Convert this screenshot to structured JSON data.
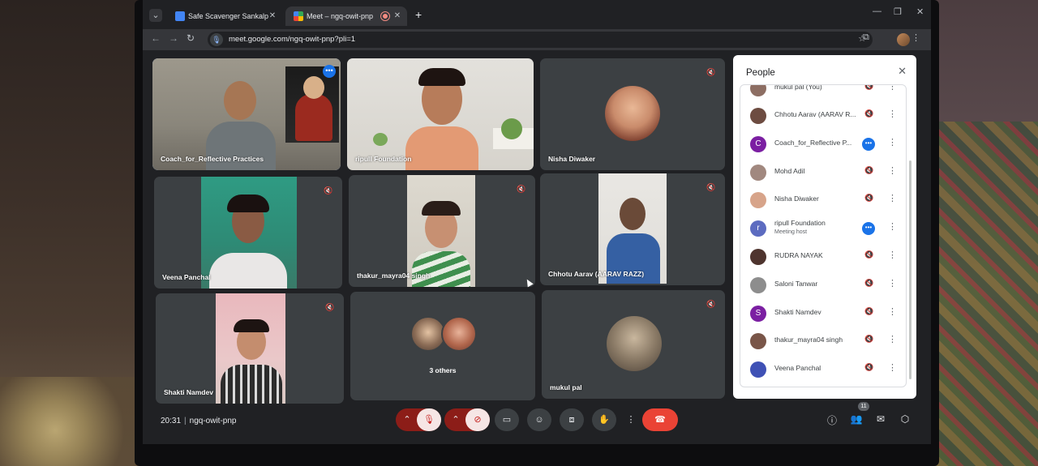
{
  "browser": {
    "tabs": [
      {
        "title": "Safe Scavenger Sankalp",
        "favicon": "docs-icon",
        "active": false
      },
      {
        "title": "Meet – ngq-owit-pnp",
        "favicon": "meet-icon",
        "active": true,
        "recording": true
      }
    ],
    "new_tab": "+",
    "url": "meet.google.com/ngq-owit-pnp?pli=1"
  },
  "tiles": [
    {
      "name": "Coach_for_Reflective Practices",
      "muted": false,
      "active": true
    },
    {
      "name": "ripull Foundation",
      "muted": false
    },
    {
      "name": "Nisha Diwaker",
      "muted": true
    },
    {
      "name": "Veena Panchal",
      "muted": true
    },
    {
      "name": "thakur_mayra04 singh",
      "muted": true
    },
    {
      "name": "Chhotu Aarav (AARAV RAZZ)",
      "muted": true
    },
    {
      "name": "Shakti Namdev",
      "muted": true
    },
    {
      "name": "3 others",
      "muted": false
    },
    {
      "name": "mukul pal",
      "muted": true
    }
  ],
  "people_panel": {
    "title": "People",
    "participants": [
      {
        "name": "mukul pal (You)",
        "initial": "",
        "color": "#8d6e63",
        "sub": "",
        "speaking": false
      },
      {
        "name": "Chhotu Aarav (AARAV R...",
        "initial": "",
        "color": "#6d4c41",
        "sub": "",
        "speaking": false
      },
      {
        "name": "Coach_for_Reflective P...",
        "initial": "C",
        "color": "#7b1fa2",
        "sub": "",
        "speaking": true
      },
      {
        "name": "Mohd Adil",
        "initial": "",
        "color": "#a1887f",
        "sub": "",
        "speaking": false
      },
      {
        "name": "Nisha Diwaker",
        "initial": "",
        "color": "#d7a48a",
        "sub": "",
        "speaking": false
      },
      {
        "name": "ripull Foundation",
        "initial": "r",
        "color": "#5c6bc0",
        "sub": "Meeting host",
        "speaking": true
      },
      {
        "name": "RUDRA NAYAK",
        "initial": "",
        "color": "#4e342e",
        "sub": "",
        "speaking": false
      },
      {
        "name": "Saloni Tanwar",
        "initial": "",
        "color": "#8d8d8d",
        "sub": "",
        "speaking": false
      },
      {
        "name": "Shakti Namdev",
        "initial": "S",
        "color": "#7b1fa2",
        "sub": "",
        "speaking": false
      },
      {
        "name": "thakur_mayra04 singh",
        "initial": "",
        "color": "#795548",
        "sub": "",
        "speaking": false
      },
      {
        "name": "Veena Panchal",
        "initial": "",
        "color": "#3f51b5",
        "sub": "",
        "speaking": false
      }
    ]
  },
  "controls": {
    "time": "20:31",
    "meeting_code": "ngq-owit-pnp",
    "participants_count": "11",
    "accent_red": "#ea4335",
    "accent_blue": "#1a73e8"
  }
}
